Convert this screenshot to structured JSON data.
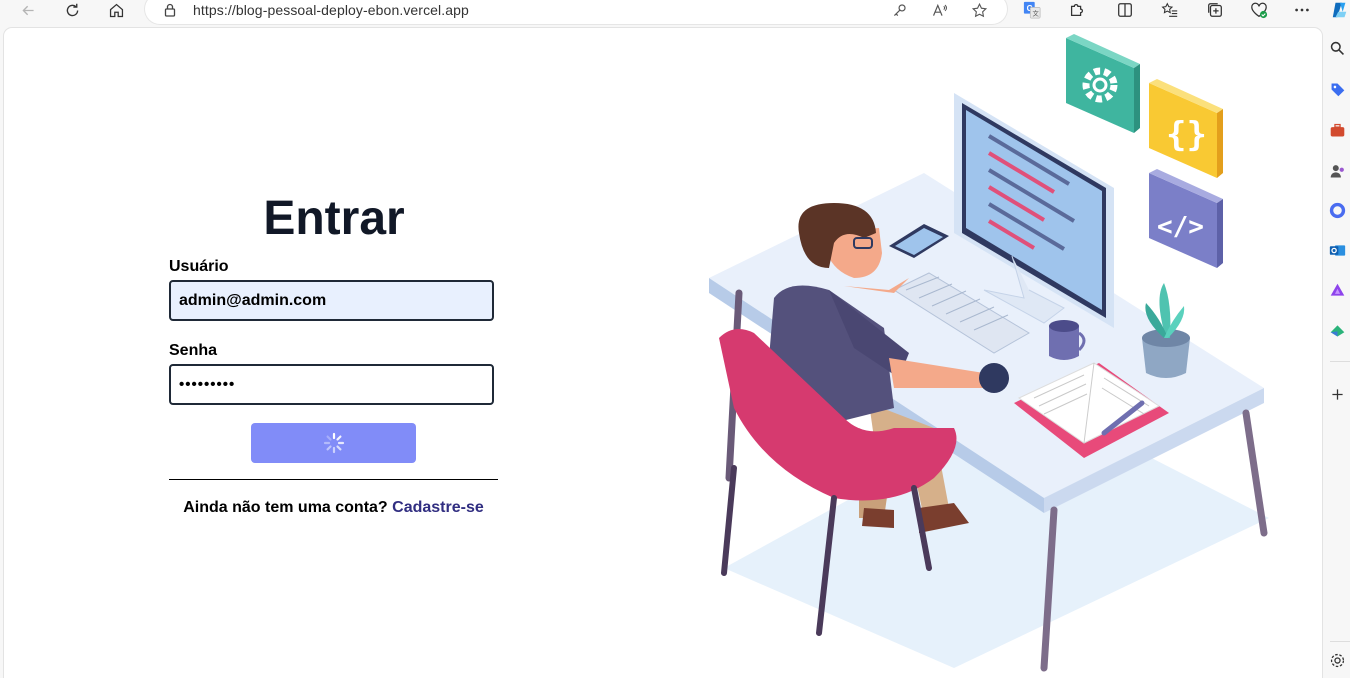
{
  "browser": {
    "url": "https://blog-pessoal-deploy-ebon.vercel.app"
  },
  "login": {
    "title": "Entrar",
    "user_label": "Usuário",
    "user_value": "admin@admin.com",
    "password_label": "Senha",
    "password_value": "•••••••••",
    "signup_prompt": "Ainda não tem uma conta?",
    "signup_link": "Cadastre-se"
  },
  "colors": {
    "button": "#818cf8",
    "link": "#312e81",
    "autofill": "#e8f0fe",
    "title": "#111827"
  },
  "icons": {
    "toolbar": [
      "back-icon",
      "refresh-icon",
      "home-icon"
    ],
    "address_actions": [
      "key-icon",
      "read-aloud-icon",
      "favorite-star-icon"
    ],
    "extensions": [
      "translate-icon",
      "extensions-puzzle-icon",
      "split-screen-icon",
      "favorites-list-icon",
      "collections-icon",
      "browser-essentials-icon",
      "more-menu-icon",
      "copilot-icon"
    ],
    "sidebar": [
      "search-icon",
      "tag-icon",
      "briefcase-icon",
      "people-icon",
      "office-icon",
      "outlook-icon",
      "games-icon",
      "tools-icon",
      "add-icon",
      "settings-icon"
    ]
  }
}
